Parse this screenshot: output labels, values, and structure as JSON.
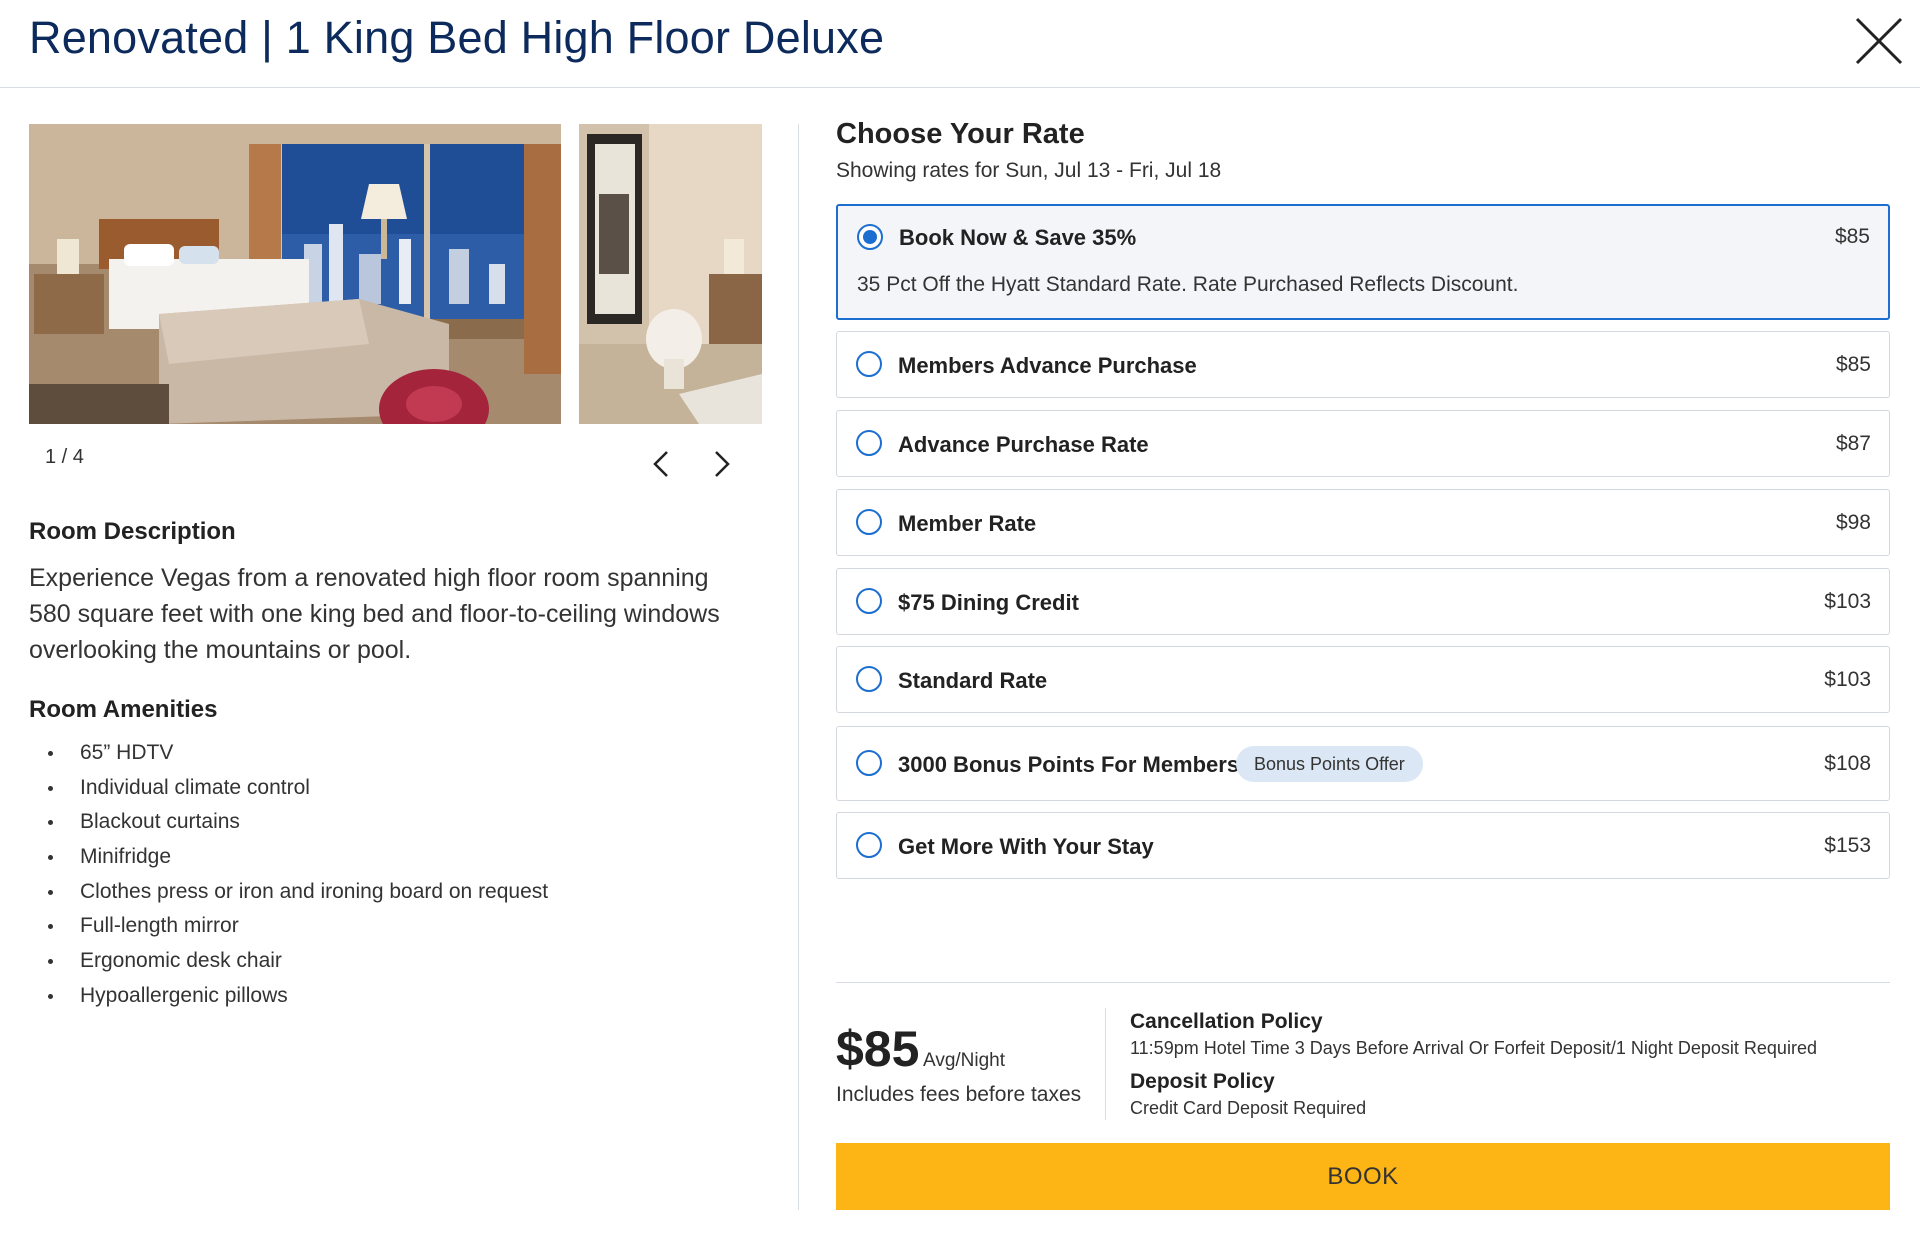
{
  "header": {
    "title": "Renovated | 1 King Bed High Floor Deluxe",
    "close_icon": "close-icon"
  },
  "gallery": {
    "counter": "1 / 4",
    "prev_icon": "chevron-left-icon",
    "next_icon": "chevron-right-icon"
  },
  "room": {
    "description_title": "Room Description",
    "description": "Experience Vegas from a renovated high floor room spanning 580 square feet with one king bed and floor-to-ceiling windows overlooking the mountains or pool.",
    "amenities_title": "Room Amenities",
    "amenities": [
      "65” HDTV",
      "Individual climate control",
      "Blackout curtains",
      "Minifridge",
      "Clothes press or iron and ironing board on request",
      "Full-length mirror",
      "Ergonomic desk chair",
      "Hypoallergenic pillows"
    ]
  },
  "rates": {
    "title": "Choose Your Rate",
    "subtitle": "Showing rates for Sun, Jul 13 - Fri, Jul 18",
    "options": [
      {
        "name": "Book Now & Save 35%",
        "price": "$85",
        "selected": true,
        "detail": "35 Pct Off the Hyatt Standard Rate. Rate Purchased Reflects Discount."
      },
      {
        "name": "Members Advance Purchase",
        "price": "$85",
        "selected": false
      },
      {
        "name": "Advance Purchase Rate",
        "price": "$87",
        "selected": false
      },
      {
        "name": "Member Rate",
        "price": "$98",
        "selected": false
      },
      {
        "name": "$75 Dining Credit",
        "price": "$103",
        "selected": false
      },
      {
        "name": "Standard Rate",
        "price": "$103",
        "selected": false
      },
      {
        "name": "3000 Bonus Points For Members",
        "price": "$108",
        "selected": false,
        "badge": "Bonus Points Offer"
      },
      {
        "name": "Get More With Your Stay",
        "price": "$153",
        "selected": false
      }
    ]
  },
  "summary": {
    "amount": "$85",
    "unit": "Avg/Night",
    "note": "Includes fees before taxes",
    "cancellation_title": "Cancellation Policy",
    "cancellation_text": "11:59pm Hotel Time 3 Days Before Arrival Or Forfeit Deposit/1 Night Deposit Required",
    "deposit_title": "Deposit Policy",
    "deposit_text": "Credit Card Deposit Required"
  },
  "book_label": "BOOK",
  "colors": {
    "title_navy": "#0c2a5c",
    "accent_blue": "#1c6fd1",
    "book_yellow": "#fdb515",
    "badge_bg": "#dbe7f4"
  }
}
